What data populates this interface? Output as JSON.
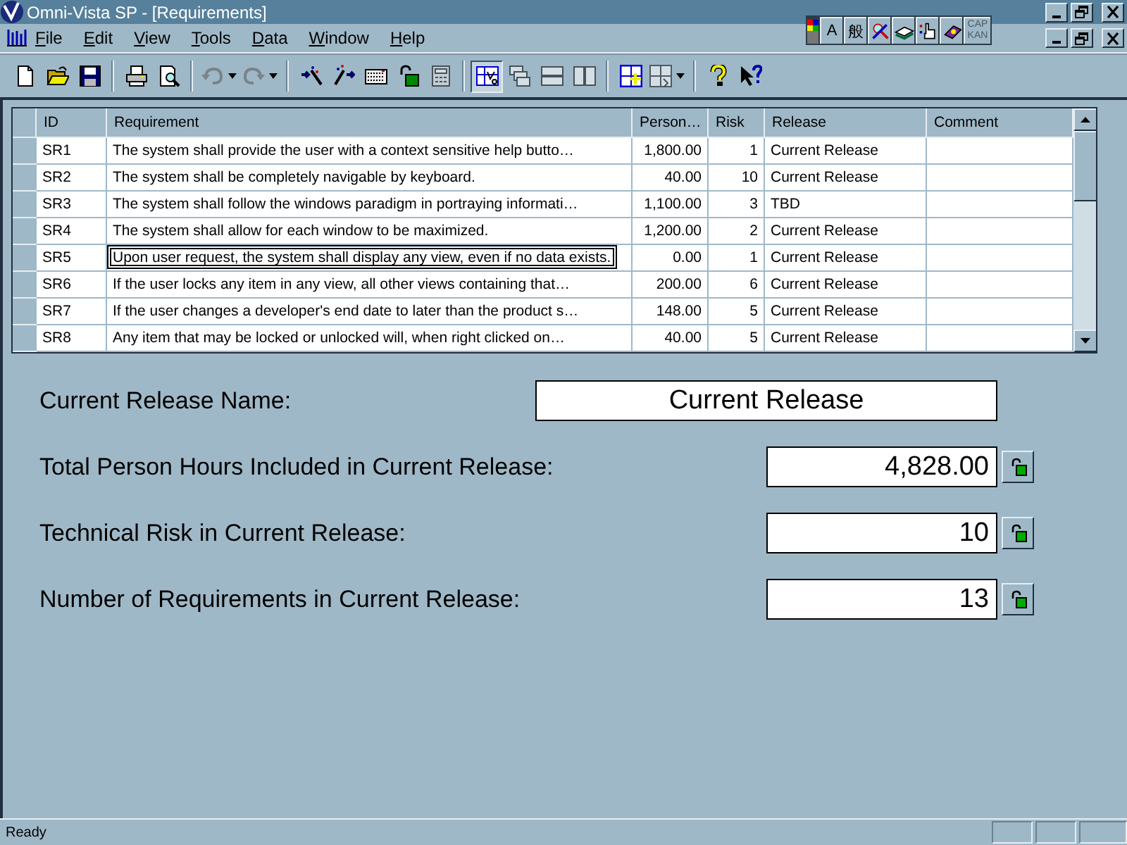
{
  "window": {
    "title": "Omni-Vista SP - [Requirements]"
  },
  "ime_toolbar": [
    {
      "kind": "palette"
    },
    {
      "kind": "text",
      "label": "A"
    },
    {
      "kind": "text",
      "label": "般"
    },
    {
      "kind": "icon"
    },
    {
      "kind": "icon"
    },
    {
      "kind": "icon"
    },
    {
      "kind": "icon"
    },
    {
      "kind": "caps",
      "lines": [
        "CAP",
        "KAN"
      ],
      "disabled": true
    }
  ],
  "menu": [
    "File",
    "Edit",
    "View",
    "Tools",
    "Data",
    "Window",
    "Help"
  ],
  "toolbar": [
    {
      "kind": "button",
      "disabled": false,
      "pressed": false
    },
    {
      "kind": "button",
      "disabled": false,
      "pressed": false
    },
    {
      "kind": "button",
      "disabled": false,
      "pressed": false
    },
    {
      "kind": "separator"
    },
    {
      "kind": "button",
      "disabled": false,
      "pressed": false
    },
    {
      "kind": "button",
      "disabled": false,
      "pressed": false
    },
    {
      "kind": "separator"
    },
    {
      "kind": "split",
      "disabled": true,
      "pressed": false
    },
    {
      "kind": "split",
      "disabled": true,
      "pressed": false
    },
    {
      "kind": "separator"
    },
    {
      "kind": "button",
      "disabled": false,
      "pressed": false
    },
    {
      "kind": "button",
      "disabled": false,
      "pressed": false
    },
    {
      "kind": "button",
      "disabled": false,
      "pressed": false
    },
    {
      "kind": "button",
      "disabled": false,
      "pressed": false
    },
    {
      "kind": "button",
      "disabled": true,
      "pressed": false
    },
    {
      "kind": "separator"
    },
    {
      "kind": "button",
      "disabled": false,
      "pressed": true
    },
    {
      "kind": "button",
      "disabled": true,
      "pressed": false
    },
    {
      "kind": "button",
      "disabled": true,
      "pressed": false
    },
    {
      "kind": "button",
      "disabled": true,
      "pressed": false
    },
    {
      "kind": "separator"
    },
    {
      "kind": "button",
      "disabled": false,
      "pressed": false
    },
    {
      "kind": "split",
      "disabled": true,
      "pressed": false
    },
    {
      "kind": "separator"
    },
    {
      "kind": "button",
      "disabled": false,
      "pressed": false
    },
    {
      "kind": "button",
      "disabled": false,
      "pressed": false
    }
  ],
  "table": {
    "columns": [
      "ID",
      "Requirement",
      "Person…",
      "Risk",
      "Release",
      "Comment"
    ],
    "rows": [
      {
        "id": "SR1",
        "requirement": "The system shall provide the user with a context sensitive help butto…",
        "person_hours": "1,800.00",
        "risk": "1",
        "release": "Current Release",
        "editing": false
      },
      {
        "id": "SR2",
        "requirement": "The system shall be completely navigable by keyboard.",
        "person_hours": "40.00",
        "risk": "10",
        "release": "Current Release",
        "editing": false
      },
      {
        "id": "SR3",
        "requirement": "The system shall follow the windows paradigm in portraying informati…",
        "person_hours": "1,100.00",
        "risk": "3",
        "release": "TBD",
        "editing": false
      },
      {
        "id": "SR4",
        "requirement": "The system shall allow for each window to be maximized.",
        "person_hours": "1,200.00",
        "risk": "2",
        "release": "Current Release",
        "editing": false
      },
      {
        "id": "SR5",
        "requirement": "Upon user request, the system shall display any view, even if no data exists.",
        "person_hours": "0.00",
        "risk": "1",
        "release": "Current Release",
        "editing": true
      },
      {
        "id": "SR6",
        "requirement": "If the user locks any item in any view, all other views containing that…",
        "person_hours": "200.00",
        "risk": "6",
        "release": "Current Release",
        "editing": false
      },
      {
        "id": "SR7",
        "requirement": "If the user changes a developer's end date to later than the product s…",
        "person_hours": "148.00",
        "risk": "5",
        "release": "Current Release",
        "editing": false
      },
      {
        "id": "SR8",
        "requirement": "Any item that may be locked or unlocked will, when right clicked on…",
        "person_hours": "40.00",
        "risk": "5",
        "release": "Current Release",
        "editing": false
      }
    ]
  },
  "summary": [
    {
      "kind": "name",
      "label": "Current Release Name:",
      "value": "Current Release"
    },
    {
      "kind": "number",
      "label": "Total Person Hours Included in Current Release:",
      "value": "4,828.00"
    },
    {
      "kind": "number",
      "label": "Technical Risk in Current Release:",
      "value": "10"
    },
    {
      "kind": "number",
      "label": "Number of Requirements in Current Release:",
      "value": "13"
    }
  ],
  "status_bar": {
    "text": "Ready"
  }
}
